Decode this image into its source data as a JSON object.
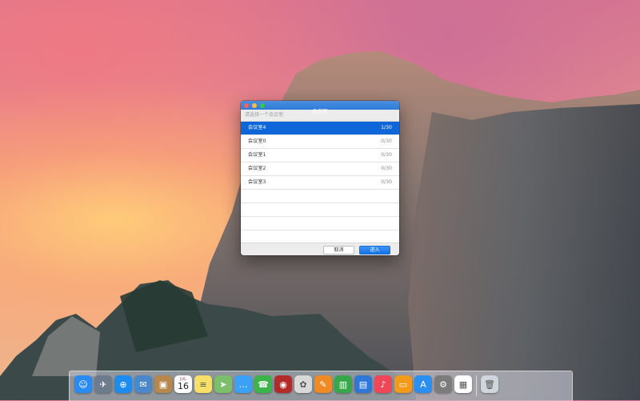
{
  "dialog": {
    "title": "会议室",
    "prompt": "请选择一个会议室:",
    "rooms": [
      {
        "name": "会议室4",
        "count": "1/30",
        "selected": true
      },
      {
        "name": "会议室0",
        "count": "0/30",
        "selected": false
      },
      {
        "name": "会议室1",
        "count": "0/30",
        "selected": false
      },
      {
        "name": "会议室2",
        "count": "0/30",
        "selected": false
      },
      {
        "name": "会议室3",
        "count": "0/30",
        "selected": false
      }
    ],
    "cancel_label": "取消",
    "enter_label": "进入"
  },
  "dock": {
    "calendar_month": "JUL",
    "calendar_day": "16",
    "apps": [
      {
        "icon": "finder-icon",
        "color": "#2a8bf2"
      },
      {
        "icon": "launchpad-icon",
        "color": "#6d7b8c"
      },
      {
        "icon": "safari-icon",
        "color": "#1d8cf0"
      },
      {
        "icon": "mail-icon",
        "color": "#4a88c9"
      },
      {
        "icon": "contacts-icon",
        "color": "#b8874c"
      },
      {
        "icon": "calendar-icon",
        "color": "#ffffff"
      },
      {
        "icon": "notes-icon",
        "color": "#f7e06a"
      },
      {
        "icon": "maps-icon",
        "color": "#7bbf6a"
      },
      {
        "icon": "messages-icon",
        "color": "#3aa1f7"
      },
      {
        "icon": "facetime-icon",
        "color": "#3bb54a"
      },
      {
        "icon": "photo-booth-icon",
        "color": "#b22b2b"
      },
      {
        "icon": "photos-icon",
        "color": "#d9d9d9"
      },
      {
        "icon": "pages-icon",
        "color": "#f08a22"
      },
      {
        "icon": "numbers-icon",
        "color": "#37a84a"
      },
      {
        "icon": "keynote-icon",
        "color": "#2f78d8"
      },
      {
        "icon": "itunes-icon",
        "color": "#f0465a"
      },
      {
        "icon": "ibooks-icon",
        "color": "#f29a1a"
      },
      {
        "icon": "app-store-icon",
        "color": "#2a8ff0"
      },
      {
        "icon": "system-preferences-icon",
        "color": "#7c7c7c"
      },
      {
        "icon": "custom-app-icon",
        "color": "#ffffff"
      },
      {
        "icon": "trash-icon",
        "color": "#cfd6de"
      }
    ]
  }
}
